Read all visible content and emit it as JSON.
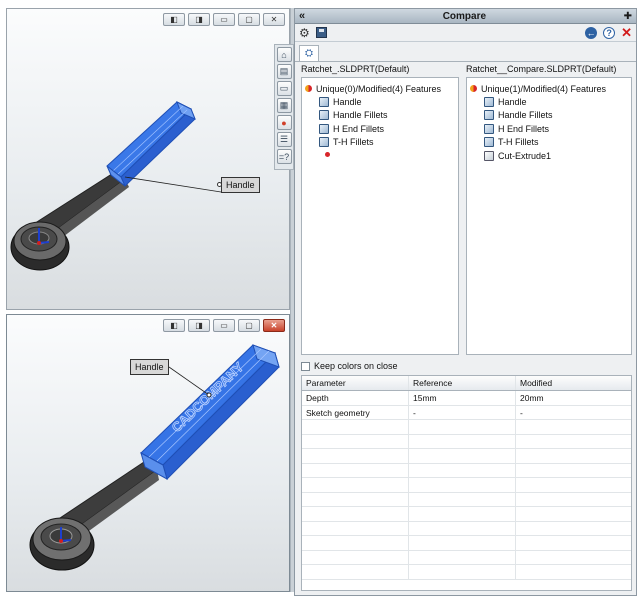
{
  "top_viewport": {
    "callout_label": "Handle",
    "window_buttons": [
      "restore-left",
      "restore-right",
      "minimize",
      "maximize",
      "close"
    ]
  },
  "bottom_viewport": {
    "callout_label": "Handle",
    "engraving": "CADCOMPANY"
  },
  "side_toolbar": {
    "icons": [
      "home-icon",
      "document-icon",
      "folder-icon",
      "report-icon",
      "color-wheel-icon",
      "list-icon",
      "help-equals-icon"
    ]
  },
  "panel": {
    "title": "Compare",
    "collapse_glyph": "«",
    "pin_glyph": "✚",
    "close_glyph": "✕",
    "back_glyph": "←",
    "help_glyph": "?",
    "left_doc": "Ratchet_.SLDPRT(Default)",
    "right_doc": "Ratchet__Compare.SLDPRT(Default)",
    "left_tree": {
      "root": "Unique(0)/Modified(4) Features",
      "items": [
        "Handle",
        "Handle Fillets",
        "H End Fillets",
        "T-H Fillets"
      ]
    },
    "right_tree": {
      "root": "Unique(1)/Modified(4) Features",
      "items": [
        "Handle",
        "Handle Fillets",
        "H End Fillets",
        "T-H Fillets",
        "Cut-Extrude1"
      ]
    },
    "keep_colors_label": "Keep colors on close",
    "grid": {
      "headers": [
        "Parameter",
        "Reference",
        "Modified"
      ],
      "rows": [
        [
          "Depth",
          "15mm",
          "20mm"
        ],
        [
          "Sketch geometry",
          "-",
          "-"
        ]
      ]
    }
  },
  "colors": {
    "highlight_blue": "#2f6fe0",
    "panel_bg": "#eef0f2",
    "close_red": "#d21b1b"
  }
}
